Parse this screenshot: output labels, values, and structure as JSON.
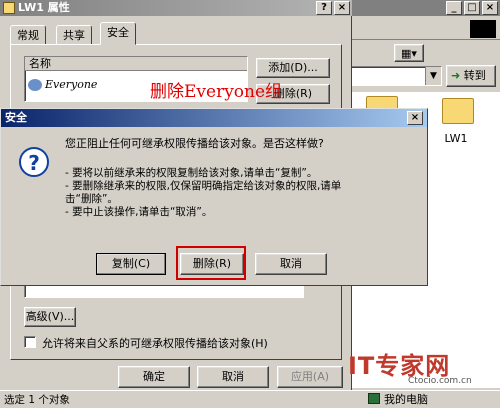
{
  "explorer": {
    "goto_label": "转到",
    "folder_label": "LW1"
  },
  "props": {
    "title": "LW1 属性",
    "tabs": [
      "常规",
      "共享",
      "安全"
    ],
    "add_button": "添加(D)...",
    "remove_button": "删除(R)",
    "list_header": "名称",
    "users": [
      "Everyone"
    ],
    "advanced_button": "高级(V)...",
    "allow_inherit_label": "允许将来自父系的可继承权限传播给该对象(H)",
    "ok_button": "确定",
    "cancel_button": "取消",
    "apply_button": "应用(A)"
  },
  "security_dialog": {
    "title": "安全",
    "question": "您正阻止任何可继承权限传播给该对象。是否这样做?",
    "lines": [
      "- 要将以前继承来的权限复制给该对象,请单击“复制”。",
      "- 要删除继承来的权限,仅保留明确指定给该对象的权限,请单",
      "击“删除”。",
      "- 要中止该操作,请单击“取消”。"
    ],
    "copy_button": "复制(C)",
    "delete_button": "删除(R)",
    "cancel_button": "取消"
  },
  "annotation": "删除Everyone组",
  "statusbar": {
    "selection_text": "选定 1 个对象",
    "location_text": "我的电脑"
  },
  "watermark": {
    "brand": "IT专家网",
    "url": "Ctocio.com.cn"
  },
  "colors": {
    "active_title": "#0a246a",
    "annotation": "#e00000",
    "highlight": "#d00000"
  }
}
